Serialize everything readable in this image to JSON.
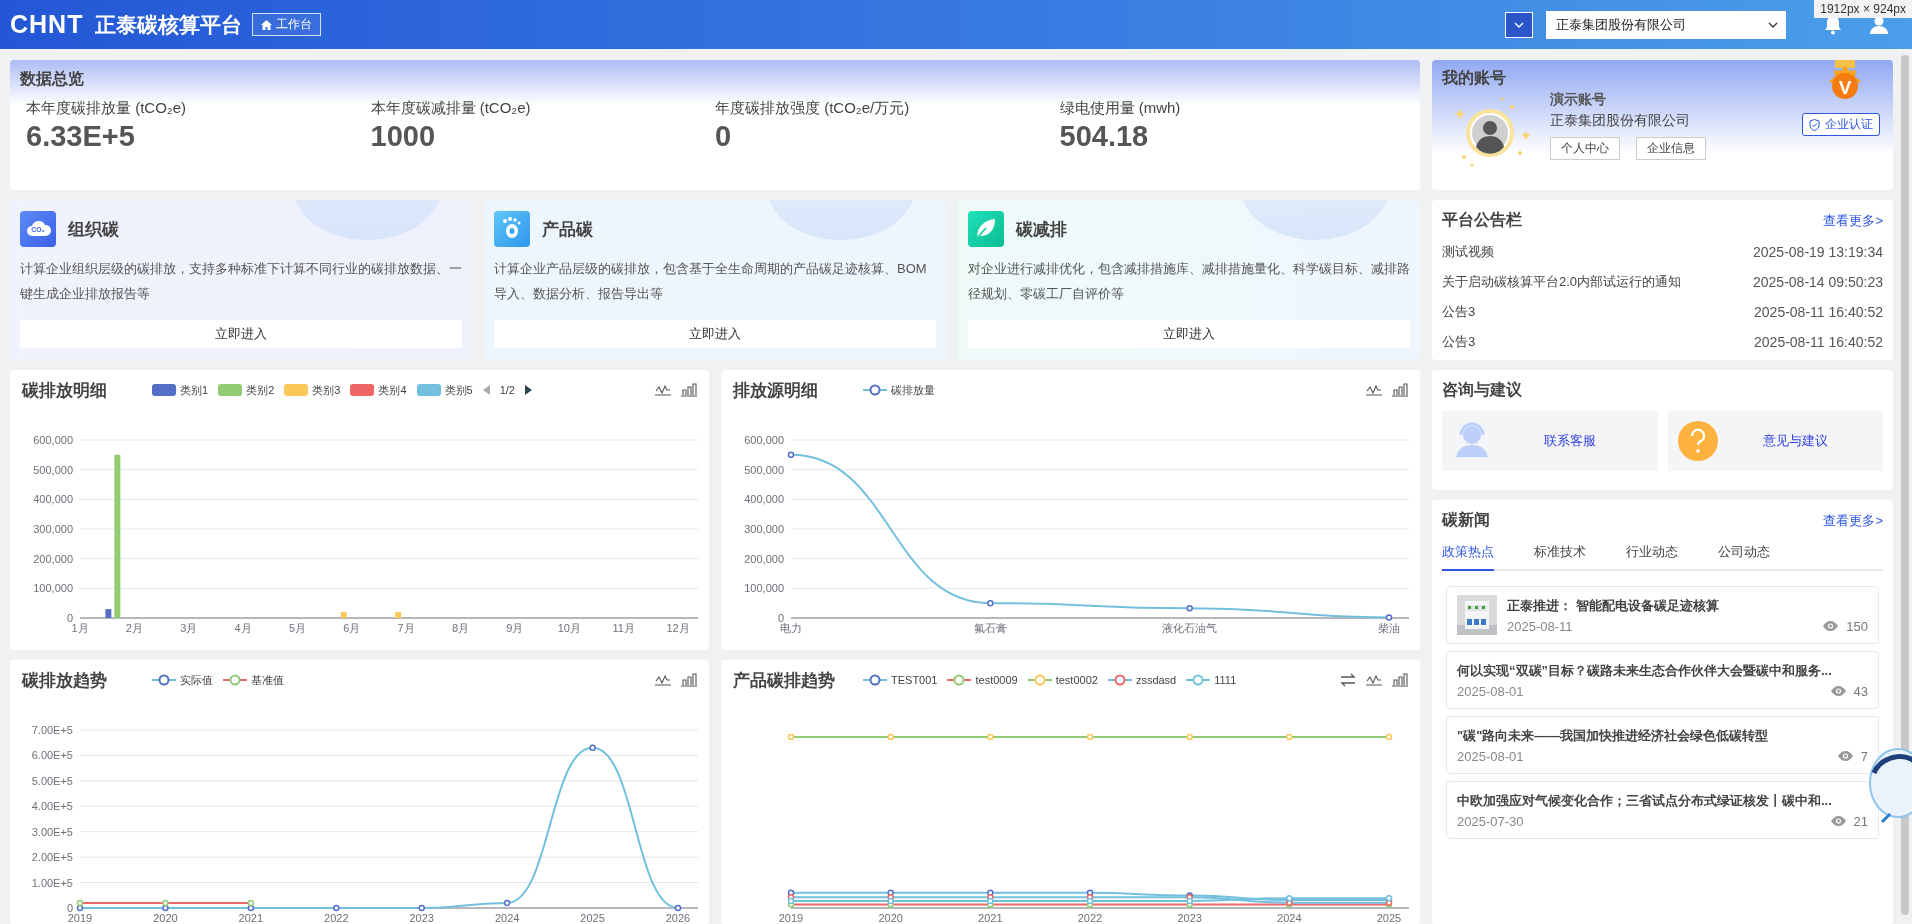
{
  "header": {
    "logo": "CHNT",
    "title": "正泰碳核算平台",
    "workbench_button": "工作台",
    "company_select": "正泰集团股份有限公司",
    "size_label": "1912px × 924px"
  },
  "overview": {
    "title": "数据总览",
    "metrics": [
      {
        "label": "本年度碳排放量 (tCO₂e)",
        "value": "6.33E+5"
      },
      {
        "label": "本年度碳减排量 (tCO₂e)",
        "value": "1000"
      },
      {
        "label": "年度碳排放强度 (tCO₂e/万元)",
        "value": "0"
      },
      {
        "label": "绿电使用量 (mwh)",
        "value": "504.18"
      }
    ]
  },
  "modules": [
    {
      "kind": "organization",
      "icon_text": "CO₂",
      "title": "组织碳",
      "description": "计算企业组织层级的碳排放，支持多种标准下计算不同行业的碳排放数据、一键生成企业排放报告等",
      "button": "立即进入"
    },
    {
      "kind": "product",
      "title": "产品碳",
      "description": "计算企业产品层级的碳排放，包含基于全生命周期的产品碳足迹核算、BOM导入、数据分析、报告导出等",
      "button": "立即进入"
    },
    {
      "kind": "reduction",
      "title": "碳减排",
      "description": "对企业进行减排优化，包含减排措施库、减排措施量化、科学碳目标、减排路径规划、零碳工厂自评价等",
      "button": "立即进入"
    }
  ],
  "charts": [
    {
      "title": "碳排放明细",
      "legend_page": "1/2",
      "tools": [
        {
          "kind": "line"
        },
        {
          "kind": "bar"
        }
      ],
      "chart_data": {
        "type": "bar",
        "grid": true,
        "legend": true,
        "categories": [
          "1月",
          "2月",
          "3月",
          "4月",
          "5月",
          "6月",
          "7月",
          "8月",
          "9月",
          "10月",
          "11月",
          "12月"
        ],
        "ylim": [
          0,
          600000
        ],
        "yticks": [
          {
            "value": 0,
            "label": "0"
          },
          {
            "value": 100000,
            "label": "100,000"
          },
          {
            "value": 200000,
            "label": "200,000"
          },
          {
            "value": 300000,
            "label": "300,000"
          },
          {
            "value": 400000,
            "label": "400,000"
          },
          {
            "value": 500000,
            "label": "500,000"
          },
          {
            "value": 600000,
            "label": "600,000"
          }
        ],
        "series": [
          {
            "name": "类别1",
            "color": "#5470c6",
            "values": [
              0,
              30000,
              0,
              0,
              0,
              0,
              0,
              0,
              0,
              0,
              0,
              0
            ]
          },
          {
            "name": "类别2",
            "color": "#91cc75",
            "values": [
              0,
              550000,
              0,
              0,
              0,
              0,
              0,
              0,
              0,
              0,
              0,
              0
            ]
          },
          {
            "name": "类别3",
            "color": "#fac858",
            "values": [
              0,
              0,
              0,
              0,
              0,
              20000,
              20000,
              0,
              0,
              0,
              0,
              0
            ]
          },
          {
            "name": "类别4",
            "color": "#ee6666",
            "values": [
              0,
              0,
              0,
              0,
              0,
              0,
              0,
              0,
              0,
              0,
              0,
              0
            ]
          },
          {
            "name": "类别5",
            "color": "#73c0de",
            "values": [
              0,
              0,
              0,
              0,
              0,
              0,
              0,
              0,
              0,
              0,
              0,
              0
            ]
          }
        ]
      }
    },
    {
      "title": "排放源明细",
      "tools": [
        {
          "kind": "line"
        },
        {
          "kind": "bar"
        }
      ],
      "chart_data": {
        "type": "line",
        "grid": true,
        "legend": true,
        "categories": [
          "电力",
          "氟石膏",
          "液化石油气",
          "柴油"
        ],
        "ylim": [
          0,
          600000
        ],
        "yticks": [
          {
            "value": 0,
            "label": "0"
          },
          {
            "value": 100000,
            "label": "100,000"
          },
          {
            "value": 200000,
            "label": "200,000"
          },
          {
            "value": 300000,
            "label": "300,000"
          },
          {
            "value": 400000,
            "label": "400,000"
          },
          {
            "value": 500000,
            "label": "500,000"
          },
          {
            "value": 600000,
            "label": "600,000"
          }
        ],
        "series": [
          {
            "name": "碳排放量",
            "color": "#73c0de",
            "marker": {
              "color": "#5470c6"
            },
            "values": [
              550000,
              50000,
              33000,
              2000
            ]
          }
        ]
      }
    },
    {
      "title": "碳排放趋势",
      "tools": [
        {
          "kind": "line"
        },
        {
          "kind": "bar"
        }
      ],
      "chart_data": {
        "type": "line",
        "grid": true,
        "legend": true,
        "categories": [
          "2019",
          "2020",
          "2021",
          "2022",
          "2023",
          "2024",
          "2025",
          "2026"
        ],
        "ylim": [
          0,
          700000
        ],
        "yticks": [
          {
            "value": 0,
            "label": "0"
          },
          {
            "value": 100000,
            "label": "1.00E+5"
          },
          {
            "value": 200000,
            "label": "2.00E+5"
          },
          {
            "value": 300000,
            "label": "3.00E+5"
          },
          {
            "value": 400000,
            "label": "4.00E+5"
          },
          {
            "value": 500000,
            "label": "5.00E+5"
          },
          {
            "value": 600000,
            "label": "6.00E+5"
          },
          {
            "value": 700000,
            "label": "7.00E+5"
          }
        ],
        "series": [
          {
            "name": "实际值",
            "color": "#73c0de",
            "marker": {
              "color": "#5470c6"
            },
            "values": [
              0,
              0,
              0,
              0,
              0,
              20000,
              630000,
              0
            ]
          },
          {
            "name": "基准值",
            "color": "#ee6666",
            "marker": {
              "color": "#91cc75"
            },
            "values": [
              20000,
              20000,
              20000,
              null,
              null,
              null,
              null,
              null
            ]
          }
        ]
      }
    },
    {
      "title": "产品碳排趋势",
      "tools": [
        {
          "kind": "swap"
        },
        {
          "kind": "line"
        },
        {
          "kind": "bar"
        }
      ],
      "x_labels": [
        "2019",
        "2020",
        "2021",
        "2022",
        "2023",
        "2024",
        "2025"
      ],
      "legend": [
        {
          "name": "TEST001",
          "color": "#73c0de",
          "marker": {
            "color": "#5470c6"
          }
        },
        {
          "name": "test0009",
          "color": "#ee6666",
          "marker": {
            "color": "#91cc75"
          }
        },
        {
          "name": "test0002",
          "color": "#91cc75",
          "marker": {
            "color": "#fac858"
          }
        },
        {
          "name": "zssdasd",
          "color": "#73c0de",
          "marker": {
            "color": "#ee6666"
          }
        },
        {
          "name": "1111",
          "color": "#73c0de",
          "marker": {
            "color": "#73c0de"
          }
        }
      ]
    }
  ],
  "account": {
    "title": "我的账号",
    "name": "演示账号",
    "company": "正泰集团股份有限公司",
    "badge_letter": "V",
    "verify_button": "企业认证",
    "buttons": [
      "个人中心",
      "企业信息"
    ]
  },
  "notices": {
    "title": "平台公告栏",
    "more": "查看更多>",
    "items": [
      {
        "title": "测试视频",
        "time": "2025-08-19 13:19:34"
      },
      {
        "title": "关于启动碳核算平台2.0内部试运行的通知",
        "time": "2025-08-14 09:50:23"
      },
      {
        "title": "公告3",
        "time": "2025-08-11 16:40:52"
      },
      {
        "title": "公告3",
        "time": "2025-08-11 16:40:52"
      }
    ]
  },
  "consult": {
    "title": "咨询与建议",
    "items": [
      {
        "kind": "service",
        "label": "联系客服"
      },
      {
        "kind": "feedback",
        "label": "意见与建议"
      }
    ]
  },
  "news": {
    "title": "碳新闻",
    "more": "查看更多>",
    "tabs": [
      {
        "label": "政策热点",
        "selected": true
      },
      {
        "label": "标准技术",
        "selected": false
      },
      {
        "label": "行业动态",
        "selected": false
      },
      {
        "label": "公司动态",
        "selected": false
      }
    ],
    "items": [
      {
        "title": "正泰推进： 智能配电设备碳足迹核算",
        "date": "2025-08-11",
        "views": "150"
      },
      {
        "title": "何以实现“双碳”目标？碳路未来生态合作伙伴大会暨碳中和服务...",
        "date": "2025-08-01",
        "views": "43"
      },
      {
        "title": "\"碳\"路向未来——我国加快推进经济社会绿色低碳转型",
        "date": "2025-08-01",
        "views": "7"
      },
      {
        "title": "中欧加强应对气候变化合作；三省试点分布式绿证核发丨碳中和...",
        "date": "2025-07-30",
        "views": "21"
      }
    ]
  }
}
